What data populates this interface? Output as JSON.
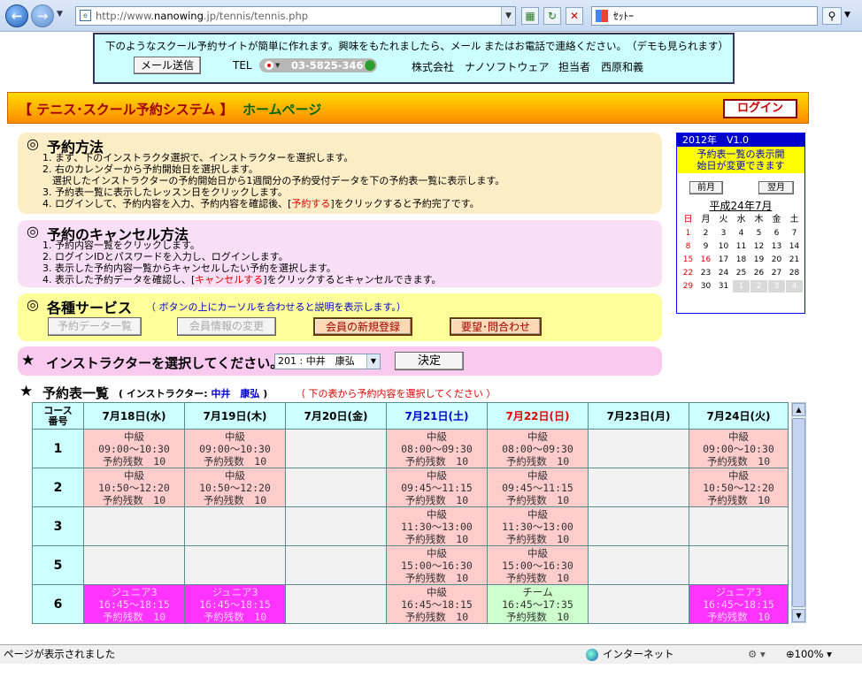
{
  "browser": {
    "url_prefix": "http://www.",
    "url_host": "nanowing",
    "url_suffix": ".jp/tennis/tennis.php",
    "search_text": "ｾｯﾄｰ",
    "status_text": "ページが表示されました",
    "zone_text": "インターネット",
    "zoom": "100%"
  },
  "banner": {
    "message": "下のようなスクール予約サイトが簡単に作れます。興味をもたれましたら、メール またはお電話で連絡ください。　（デモも見られます）",
    "mail_button": "メール送信",
    "tel_label": "TEL",
    "phone": "03-5825-3466",
    "company": "株式会社　ナノソフトウェア",
    "contact": "担当者　西原和義"
  },
  "header": {
    "title": "【 テニス･スクール予約システム 】",
    "subtitle": "ホームページ",
    "login": "ログイン"
  },
  "howto": {
    "title": "予約方法",
    "l1": "1. まず、下のインストラクタ選択で、インストラクターを選択します。",
    "l2": "2. 右のカレンダーから予約開始日を選択します。",
    "l3": "　選択したインストラクターの予約開始日から1週間分の予約受付データを下の予約表一覧に表示します。",
    "l4": "3. 予約表一覧に表示したレッスン日をクリックします。",
    "l5a": "4. ログインして、予約内容を入力、予約内容を確認後、[",
    "l5b": "予約する",
    "l5c": "]をクリックすると予約完了です。"
  },
  "cancel": {
    "title": "予約のキャンセル方法",
    "l1": "1. 予約内容一覧をクリックします。",
    "l2": "2. ログインIDとパスワードを入力し、ログインします。",
    "l3": "3. 表示した予約内容一覧からキャンセルしたい予約を選択します。",
    "l4a": "4. 表示した予約データを確認し、[",
    "l4b": "キャンセルする",
    "l4c": "]をクリックするとキャンセルできます。"
  },
  "services": {
    "title": "各種サービス",
    "hint": "（ ボタンの上にカーソルを合わせると説明を表示します。）",
    "b1": "予約データ一覧",
    "b2": "会員情報の変更",
    "b3": "会員の新規登録",
    "b4": "要望･問合わせ"
  },
  "instructor": {
    "label": "インストラクターを選択してください。",
    "selected": "201 : 中井　康弘",
    "decide": "決定"
  },
  "schedule": {
    "title": "予約表一覧",
    "paren_open": "( インストラクター: ",
    "instructor_name": "中井　康弘",
    "paren_close": " )",
    "note": "（ 下の表から予約内容を選択してください ）",
    "corner_l1": "コース",
    "corner_l2": "番号",
    "days": [
      {
        "label": "7月18日(水)",
        "color": "#000000"
      },
      {
        "label": "7月19日(木)",
        "color": "#000000"
      },
      {
        "label": "7月20日(金)",
        "color": "#000000"
      },
      {
        "label": "7月21日(土)",
        "color": "#0000cc"
      },
      {
        "label": "7月22日(日)",
        "color": "#e00000"
      },
      {
        "label": "7月23日(月)",
        "color": "#000000"
      },
      {
        "label": "7月24日(火)",
        "color": "#000000"
      }
    ],
    "rows": [
      {
        "num": "1",
        "cells": [
          {
            "t": "中級",
            "time": "09:00～10:30",
            "rem": "予約残数　10",
            "style": "pink"
          },
          {
            "t": "中級",
            "time": "09:00～10:30",
            "rem": "予約残数　10",
            "style": "pink"
          },
          {
            "t": "",
            "time": "",
            "rem": "",
            "style": "emp"
          },
          {
            "t": "中級",
            "time": "08:00～09:30",
            "rem": "予約残数　10",
            "style": "pink"
          },
          {
            "t": "中級",
            "time": "08:00～09:30",
            "rem": "予約残数　10",
            "style": "pink"
          },
          {
            "t": "",
            "time": "",
            "rem": "",
            "style": "emp"
          },
          {
            "t": "中級",
            "time": "09:00～10:30",
            "rem": "予約残数　10",
            "style": "pink"
          }
        ]
      },
      {
        "num": "2",
        "cells": [
          {
            "t": "中級",
            "time": "10:50～12:20",
            "rem": "予約残数　10",
            "style": "pink"
          },
          {
            "t": "中級",
            "time": "10:50～12:20",
            "rem": "予約残数　10",
            "style": "pink"
          },
          {
            "t": "",
            "time": "",
            "rem": "",
            "style": "emp"
          },
          {
            "t": "中級",
            "time": "09:45～11:15",
            "rem": "予約残数　10",
            "style": "pink"
          },
          {
            "t": "中級",
            "time": "09:45～11:15",
            "rem": "予約残数　10",
            "style": "pink"
          },
          {
            "t": "",
            "time": "",
            "rem": "",
            "style": "emp"
          },
          {
            "t": "中級",
            "time": "10:50～12:20",
            "rem": "予約残数　10",
            "style": "pink"
          }
        ]
      },
      {
        "num": "3",
        "cells": [
          {
            "t": "",
            "time": "",
            "rem": "",
            "style": "emp"
          },
          {
            "t": "",
            "time": "",
            "rem": "",
            "style": "emp"
          },
          {
            "t": "",
            "time": "",
            "rem": "",
            "style": "emp"
          },
          {
            "t": "中級",
            "time": "11:30～13:00",
            "rem": "予約残数　10",
            "style": "pink"
          },
          {
            "t": "中級",
            "time": "11:30～13:00",
            "rem": "予約残数　10",
            "style": "pink"
          },
          {
            "t": "",
            "time": "",
            "rem": "",
            "style": "emp"
          },
          {
            "t": "",
            "time": "",
            "rem": "",
            "style": "emp"
          }
        ]
      },
      {
        "num": "5",
        "cells": [
          {
            "t": "",
            "time": "",
            "rem": "",
            "style": "emp"
          },
          {
            "t": "",
            "time": "",
            "rem": "",
            "style": "emp"
          },
          {
            "t": "",
            "time": "",
            "rem": "",
            "style": "emp"
          },
          {
            "t": "中級",
            "time": "15:00～16:30",
            "rem": "予約残数　10",
            "style": "pink"
          },
          {
            "t": "中級",
            "time": "15:00～16:30",
            "rem": "予約残数　10",
            "style": "pink"
          },
          {
            "t": "",
            "time": "",
            "rem": "",
            "style": "emp"
          },
          {
            "t": "",
            "time": "",
            "rem": "",
            "style": "emp"
          }
        ]
      },
      {
        "num": "6",
        "cells": [
          {
            "t": "ジュニア3",
            "time": "16:45～18:15",
            "rem": "予約残数　10",
            "style": "mag"
          },
          {
            "t": "ジュニア3",
            "time": "16:45～18:15",
            "rem": "予約残数　10",
            "style": "mag"
          },
          {
            "t": "",
            "time": "",
            "rem": "",
            "style": "emp"
          },
          {
            "t": "中級",
            "time": "16:45～18:15",
            "rem": "予約残数　10",
            "style": "pink"
          },
          {
            "t": "チーム",
            "time": "16:45～17:35",
            "rem": "予約残数　10",
            "style": "grn"
          },
          {
            "t": "",
            "time": "",
            "rem": "",
            "style": "emp"
          },
          {
            "t": "ジュニア3",
            "time": "16:45～18:15",
            "rem": "予約残数　10",
            "style": "mag"
          }
        ]
      }
    ]
  },
  "calendar": {
    "header": "2012年　V1.0",
    "msg_l1": "予約表一覧の表示開",
    "msg_l2": "始日が変更できます",
    "prev": "前月",
    "next": "翌月",
    "month": "平成24年7月",
    "weekdays": [
      "日",
      "月",
      "火",
      "水",
      "木",
      "金",
      "土"
    ],
    "weeks": [
      [
        "1",
        "2",
        "3",
        "4",
        "5",
        "6",
        "7"
      ],
      [
        "8",
        "9",
        "10",
        "11",
        "12",
        "13",
        "14"
      ],
      [
        "15",
        "16",
        "17",
        "18",
        "19",
        "20",
        "21"
      ],
      [
        "22",
        "23",
        "24",
        "25",
        "26",
        "27",
        "28"
      ],
      [
        "29",
        "30",
        "31",
        "1",
        "2",
        "3",
        "4"
      ]
    ]
  }
}
